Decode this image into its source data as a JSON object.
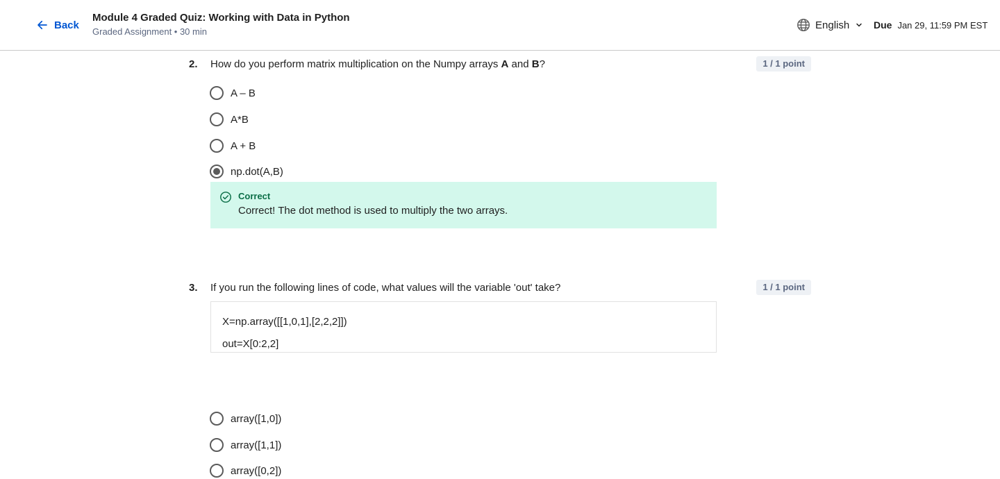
{
  "header": {
    "back_label": "Back",
    "title": "Module 4 Graded Quiz: Working with Data in Python",
    "subtitle": "Graded Assignment • 30 min",
    "language": "English",
    "due_label": "Due",
    "due_date": "Jan 29, 11:59 PM EST"
  },
  "questions": [
    {
      "number": "2.",
      "text_before": "How do you perform matrix multiplication on the Numpy arrays ",
      "bold1": "A",
      "text_mid": " and ",
      "bold2": "B",
      "text_after": "?",
      "points": "1 / 1 point",
      "options": [
        "A – B",
        "A*B",
        "A + B",
        "np.dot(A,B)"
      ],
      "selected_index": 3,
      "feedback": {
        "title": "Correct",
        "text": "Correct! The dot method is used to multiply the two arrays."
      }
    },
    {
      "number": "3.",
      "text": "If you run the following lines of code, what values will the variable 'out' take?",
      "points": "1 / 1 point",
      "code": [
        "X=np.array([[1,0,1],[2,2,2]])",
        "out=X[0:2,2]"
      ],
      "options": [
        "array([1,0])",
        "array([1,1])",
        "array([0,2])"
      ]
    }
  ],
  "colors": {
    "accent": "#0056d2",
    "correct_bg": "#d3f8ec",
    "correct_text": "#0b6e47",
    "points_bg": "#eef1f5"
  }
}
